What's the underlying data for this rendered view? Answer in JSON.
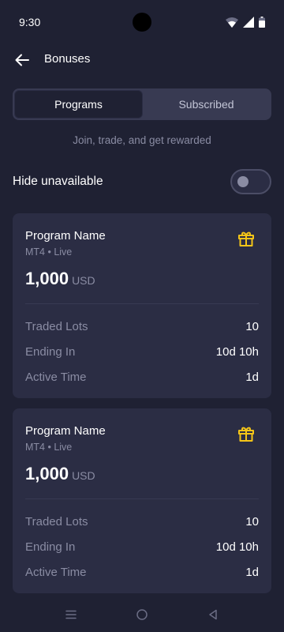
{
  "status": {
    "time": "9:30"
  },
  "header": {
    "title": "Bonuses"
  },
  "tabs": [
    {
      "label": "Programs",
      "active": true
    },
    {
      "label": "Subscribed",
      "active": false
    }
  ],
  "subtitle": "Join, trade, and get rewarded",
  "filter": {
    "label": "Hide unavailable",
    "enabled": false
  },
  "cards": [
    {
      "name": "Program Name",
      "meta": "MT4 • Live",
      "amount": "1,000",
      "currency": "USD",
      "icon": "gift-icon",
      "stats": [
        {
          "label": "Traded Lots",
          "value": "10"
        },
        {
          "label": "Ending In",
          "value": "10d 10h"
        },
        {
          "label": "Active Time",
          "value": "1d"
        }
      ]
    },
    {
      "name": "Program Name",
      "meta": "MT4 • Live",
      "amount": "1,000",
      "currency": "USD",
      "icon": "gift-icon",
      "stats": [
        {
          "label": "Traded Lots",
          "value": "10"
        },
        {
          "label": "Ending In",
          "value": "10d 10h"
        },
        {
          "label": "Active Time",
          "value": "1d"
        }
      ]
    }
  ],
  "colors": {
    "background": "#1f2133",
    "card": "#2b2d44",
    "accent": "#f5c518",
    "muted_text": "#8a8ca3"
  }
}
